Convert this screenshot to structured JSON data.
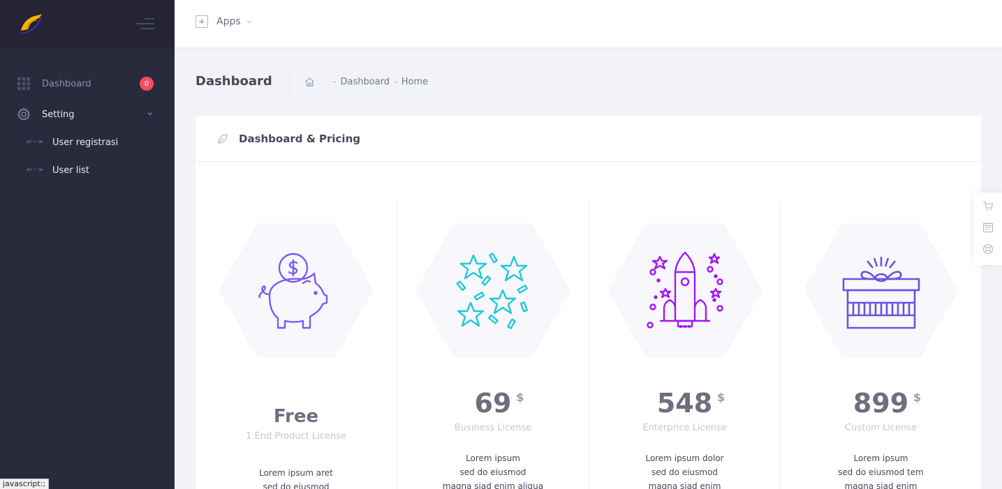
{
  "sidebar": {
    "menu": {
      "dashboard": {
        "label": "Dashboard",
        "badge": "0"
      },
      "setting": {
        "label": "Setting"
      },
      "sub_items": [
        {
          "label": "User registrasi"
        },
        {
          "label": "User list"
        }
      ]
    }
  },
  "header": {
    "apps_label": "Apps"
  },
  "subheader": {
    "title": "Dashboard",
    "breadcrumbs": [
      "Dashboard",
      "Home"
    ],
    "separator": "-"
  },
  "card": {
    "title": "Dashboard & Pricing",
    "plans": [
      {
        "price": "Free",
        "currency": "",
        "license": "1 End Product License",
        "description": [
          "Lorem ipsum aret",
          "sed do eiusmod"
        ],
        "icon": "piggy-bank-icon"
      },
      {
        "price": "69",
        "currency": "$",
        "license": "Business License",
        "description": [
          "Lorem ipsum",
          "sed do eiusmod",
          "magna siad enim aliqua"
        ],
        "icon": "stars-confetti-icon"
      },
      {
        "price": "548",
        "currency": "$",
        "license": "Enterprice License",
        "description": [
          "Lorem ipsum dolor",
          "sed do eiusmod",
          "magna siad enim"
        ],
        "icon": "rocket-icon"
      },
      {
        "price": "899",
        "currency": "$",
        "license": "Custom License",
        "description": [
          "Lorem ipsum",
          "sed do eiusmod tem",
          "magna siad enim"
        ],
        "icon": "gift-box-icon"
      }
    ]
  },
  "quick_panel": {
    "icons": [
      "cart-icon",
      "calendar-icon",
      "lifebuoy-icon"
    ]
  },
  "status_bar": {
    "text": "javascript:;"
  },
  "colors": {
    "sidebar_bg": "#2a2a3d",
    "brand_bg": "#242435",
    "badge": "#f64e60",
    "purple": "#7a5af8",
    "cyan": "#1fc9d8",
    "magenta": "#a316f5",
    "indigo": "#6a52e0"
  }
}
